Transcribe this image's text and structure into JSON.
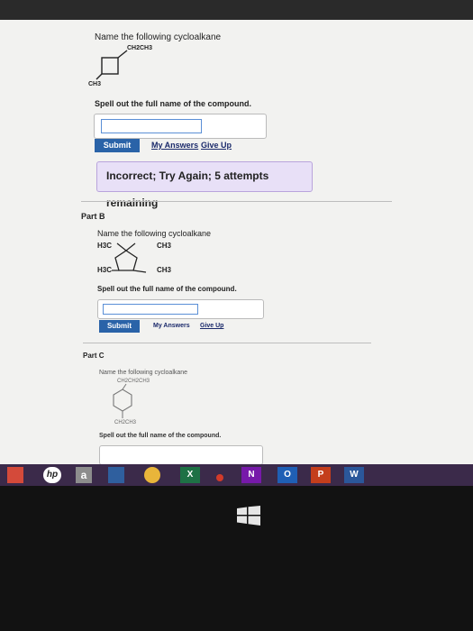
{
  "partA": {
    "prompt": "Name the following cycloalkane",
    "sub_top": "CH2CH3",
    "sub_bottom": "CH3",
    "instruction": "Spell out the full name of the compound.",
    "submit_label": "Submit",
    "my_answers_label": "My Answers",
    "give_up_label": "Give Up",
    "feedback": "Incorrect; Try Again; 5 attempts remaining"
  },
  "partB": {
    "title": "Part B",
    "prompt": "Name the following cycloalkane",
    "sub_tl": "H3C",
    "sub_tr": "CH3",
    "sub_bl": "H3C",
    "sub_br": "CH3",
    "instruction": "Spell out the full name of the compound.",
    "submit_label": "Submit",
    "my_answers_label": "My Answers",
    "give_up_label": "Give Up"
  },
  "partC": {
    "title": "Part C",
    "prompt": "Name the following cycloalkane",
    "sub_top": "CH2CH2CH3",
    "sub_bottom": "CH2CH3",
    "instruction": "Spell out the full name of the compound."
  },
  "taskbar": {
    "apps": [
      {
        "name": "hp",
        "label": "hp",
        "color": "#ffffff"
      },
      {
        "name": "amazon",
        "label": "a",
        "color": "#8d8d8d"
      },
      {
        "name": "chrome",
        "label": "",
        "color": "#e9b53a"
      },
      {
        "name": "excel",
        "label": "X",
        "color": "#1e7145"
      },
      {
        "name": "onenote",
        "label": "N",
        "color": "#7719aa"
      },
      {
        "name": "outlook",
        "label": "O",
        "color": "#1f5fb5"
      },
      {
        "name": "powerpoint",
        "label": "P",
        "color": "#c43e1c"
      },
      {
        "name": "word",
        "label": "W",
        "color": "#2b579a"
      }
    ]
  }
}
